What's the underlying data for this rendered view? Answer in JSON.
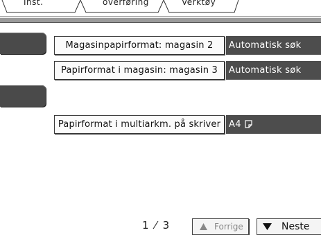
{
  "tabs": [
    {
      "label": "Inst."
    },
    {
      "label": "overføring"
    },
    {
      "label": "Verktøy"
    }
  ],
  "settings": [
    {
      "label": "Magasinpapirformat: magasin 2",
      "value": "Automatisk søk"
    },
    {
      "label": "Papirformat i magasin: magasin 3",
      "value": "Automatisk søk"
    },
    {
      "label": "Papirformat i multiarkm. på skriver",
      "value": "A4",
      "value_icon": "portrait-paper-icon"
    }
  ],
  "pagination": {
    "current": "1",
    "separator": "/",
    "total": "3",
    "text": "1 ⁄ 3",
    "prev_label": "Forrige",
    "next_label": "Neste",
    "prev_icon": "triangle-up-icon",
    "next_icon": "triangle-down-icon"
  }
}
